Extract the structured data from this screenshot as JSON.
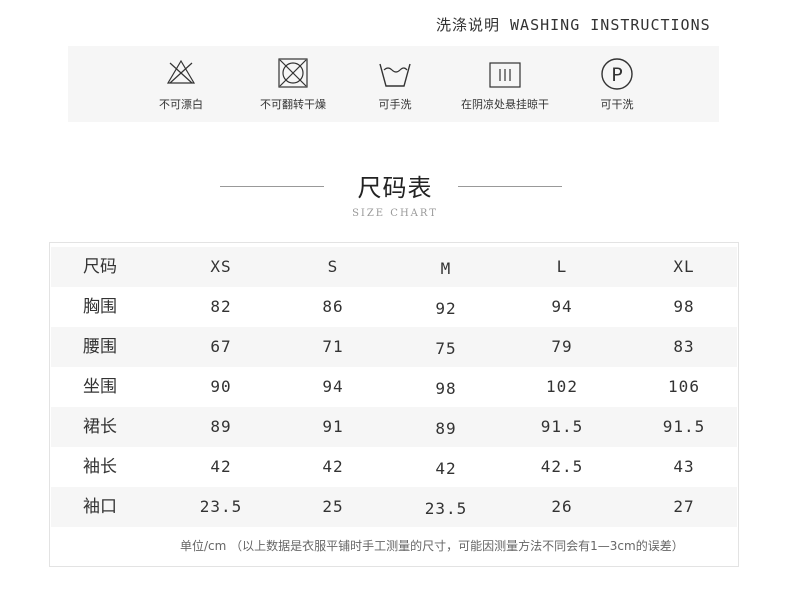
{
  "washing": {
    "title": "洗涤说明 WASHING INSTRUCTIONS",
    "items": [
      {
        "icon": "no-bleach-icon",
        "label": "不可漂白"
      },
      {
        "icon": "no-tumble-dry-icon",
        "label": "不可翻转干燥"
      },
      {
        "icon": "hand-wash-icon",
        "label": "可手洗"
      },
      {
        "icon": "shade-line-dry-icon",
        "label": "在阴凉处悬挂晾干"
      },
      {
        "icon": "dry-clean-p-icon",
        "label": "可干洗",
        "letter": "P"
      }
    ]
  },
  "size_chart": {
    "title": "尺码表",
    "subtitle": "SIZE CHART",
    "header": [
      "尺码",
      "XS",
      "S",
      "M",
      "L",
      "XL"
    ],
    "rows": [
      [
        "胸围",
        "82",
        "86",
        "92",
        "94",
        "98"
      ],
      [
        "腰围",
        "67",
        "71",
        "75",
        "79",
        "83"
      ],
      [
        "坐围",
        "90",
        "94",
        "98",
        "102",
        "106"
      ],
      [
        "裙长",
        "89",
        "91",
        "89",
        "91.5",
        "91.5"
      ],
      [
        "袖长",
        "42",
        "42",
        "42",
        "42.5",
        "43"
      ],
      [
        "袖口",
        "23.5",
        "25",
        "23.5",
        "26",
        "27"
      ]
    ],
    "footnote": "单位/cm （以上数据是衣服平铺时手工测量的尺寸，可能因测量方法不同会有1—3cm的误差）"
  },
  "colors": {
    "panel_bg": "#f6f6f6",
    "text": "#333333",
    "muted": "#999999"
  }
}
